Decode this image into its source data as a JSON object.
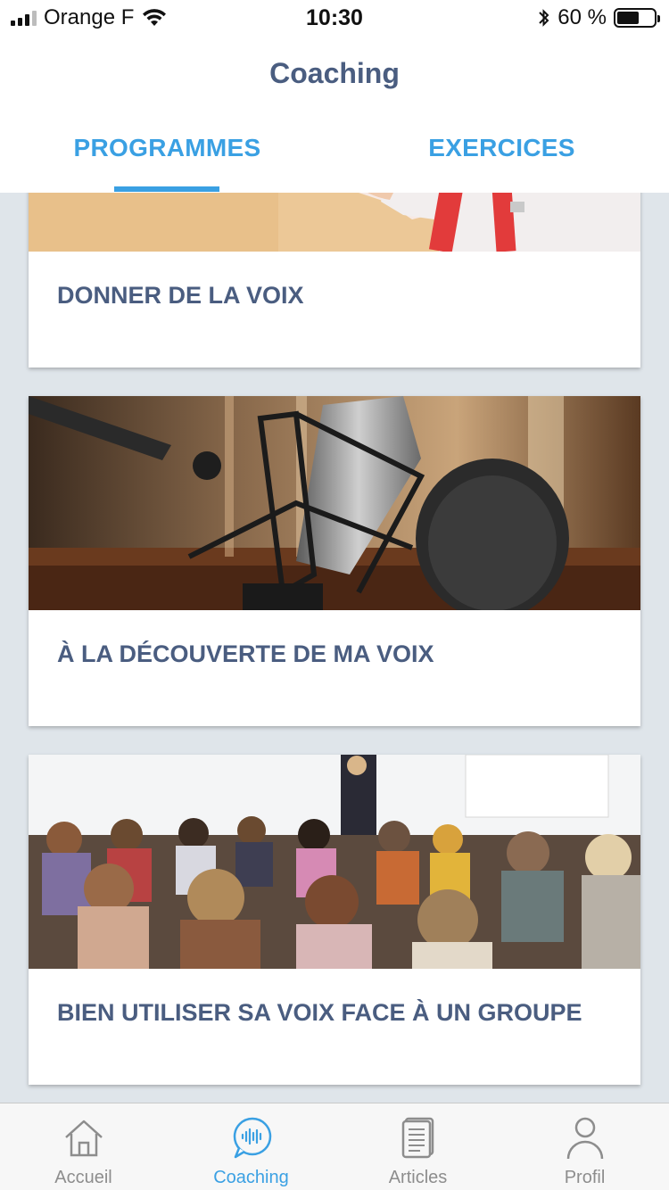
{
  "status_bar": {
    "carrier": "Orange F",
    "time": "10:30",
    "battery_text": "60 %",
    "battery_level": 0.6
  },
  "header": {
    "title": "Coaching",
    "tabs": [
      {
        "label": "PROGRAMMES",
        "active": true
      },
      {
        "label": "EXERCICES",
        "active": false
      }
    ]
  },
  "programmes": [
    {
      "title": "DONNER DE LA VOIX",
      "image": "speaker-suspenders-photo"
    },
    {
      "title": "À LA DÉCOUVERTE DE MA VOIX",
      "image": "studio-microphone-photo"
    },
    {
      "title": "BIEN UTILISER SA VOIX FACE À UN GROUPE",
      "image": "conference-audience-photo"
    }
  ],
  "tabbar": {
    "items": [
      {
        "label": "Accueil",
        "icon": "home-icon",
        "active": false
      },
      {
        "label": "Coaching",
        "icon": "voice-bubble-icon",
        "active": true
      },
      {
        "label": "Articles",
        "icon": "document-icon",
        "active": false
      },
      {
        "label": "Profil",
        "icon": "user-icon",
        "active": false
      }
    ]
  },
  "colors": {
    "accent": "#3aa0e3",
    "title_text": "#4a5d80",
    "background": "#dfe5ea",
    "inactive_tab": "#8d8d8d"
  }
}
